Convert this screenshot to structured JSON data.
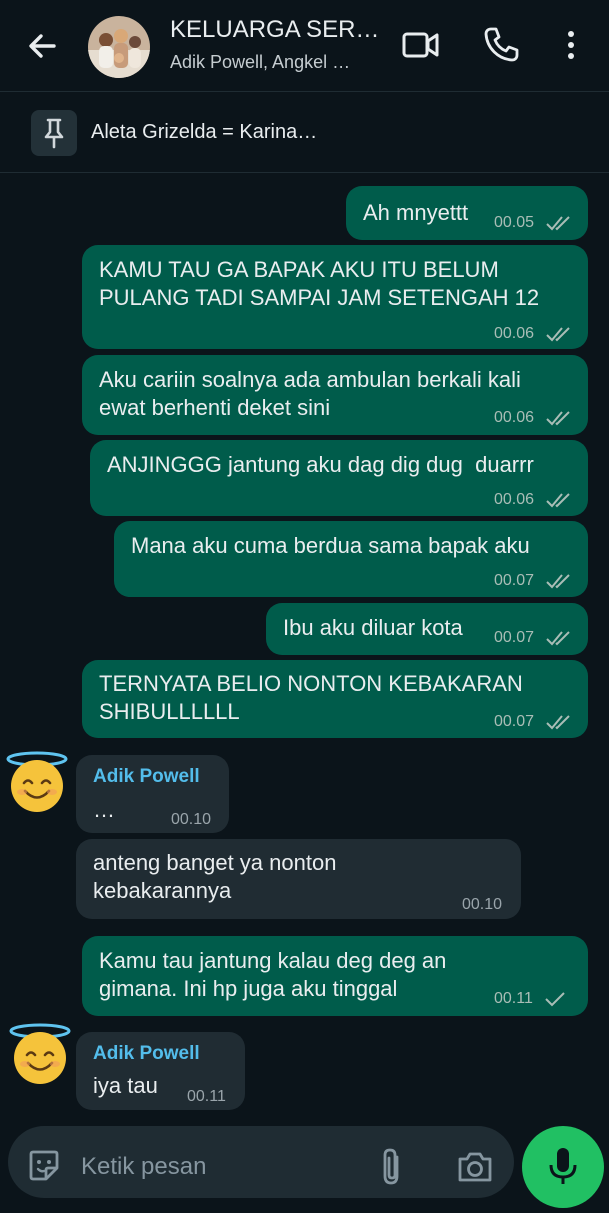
{
  "header": {
    "title": "KELUARGA SER…",
    "subtitle": "Adik Powell, Angkel …"
  },
  "pinned": {
    "text": "Aleta Grizelda = Karina…"
  },
  "messages": [
    {
      "lines": [
        "Ah mnyettt"
      ],
      "time": "00.05",
      "status": "read"
    },
    {
      "lines": [
        "KAMU TAU GA BAPAK AKU ITU BELUM",
        "PULANG TADI SAMPAI JAM SETENGAH 12"
      ],
      "time": "00.06",
      "status": "read"
    },
    {
      "lines": [
        "Aku cariin soalnya ada ambulan berkali kali",
        "ewat berhenti deket sini"
      ],
      "time": "00.06",
      "status": "read"
    },
    {
      "lines": [
        "ANJINGGG jantung aku dag dig dug  duarrr"
      ],
      "time": "00.06",
      "status": "read"
    },
    {
      "lines": [
        "Mana aku cuma berdua sama bapak aku"
      ],
      "time": "00.07",
      "status": "read"
    },
    {
      "lines": [
        "Ibu aku diluar kota"
      ],
      "time": "00.07",
      "status": "read"
    },
    {
      "lines": [
        "TERNYATA BELIO NONTON KEBAKARAN",
        "SHIBULLLLLL"
      ],
      "time": "00.07",
      "status": "read"
    },
    {
      "sender": "Adik Powell",
      "lines": [
        "…"
      ],
      "time": "00.10"
    },
    {
      "lines": [
        "anteng banget ya nonton",
        "kebakarannya"
      ],
      "time": "00.10"
    },
    {
      "lines": [
        "Kamu tau jantung kalau deg deg an",
        "gimana. Ini hp juga aku tinggal"
      ],
      "time": "00.11",
      "status": "sent"
    },
    {
      "sender": "Adik Powell",
      "lines": [
        "iya tau"
      ],
      "time": "00.11"
    }
  ],
  "composer": {
    "placeholder": "Ketik pesan"
  },
  "colors": {
    "background": "#0b141a",
    "outgoing_bubble": "#005c4b",
    "incoming_bubble": "#202c33",
    "sender_name": "#53bdeb",
    "mic_button": "#21c063"
  },
  "icons": [
    "back-arrow-icon",
    "video-call-icon",
    "phone-icon",
    "more-vert-icon",
    "pin-icon",
    "sticker-icon",
    "attach-icon",
    "camera-icon",
    "mic-icon",
    "read-ticks-icon",
    "sent-tick-icon"
  ]
}
